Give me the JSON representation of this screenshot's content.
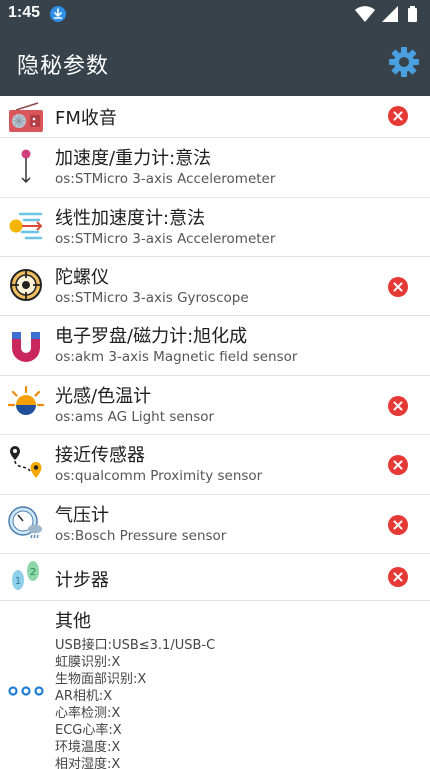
{
  "status": {
    "time": "1:45"
  },
  "app": {
    "title": "隐秘参数"
  },
  "sensors": [
    {
      "title": "FM收音",
      "sub": "",
      "icon": "radio-icon",
      "removable": true
    },
    {
      "title": "加速度/重力计:意法",
      "sub": "os:STMicro 3-axis Accelerometer",
      "icon": "accelerometer-icon",
      "removable": false
    },
    {
      "title": "线性加速度计:意法",
      "sub": "os:STMicro 3-axis Accelerometer",
      "icon": "linear-acceleration-icon",
      "removable": false
    },
    {
      "title": "陀螺仪",
      "sub": "os:STMicro 3-axis Gyroscope",
      "icon": "gyroscope-icon",
      "removable": true
    },
    {
      "title": "电子罗盘/磁力计:旭化成",
      "sub": "os:akm 3-axis Magnetic field sensor",
      "icon": "magnet-icon",
      "removable": false
    },
    {
      "title": "光感/色温计",
      "sub": "os:ams AG Light sensor",
      "icon": "light-sensor-icon",
      "removable": true
    },
    {
      "title": "接近传感器",
      "sub": "os:qualcomm Proximity sensor",
      "icon": "proximity-route-icon",
      "removable": true
    },
    {
      "title": "气压计",
      "sub": "os:Bosch Pressure sensor",
      "icon": "barometer-icon",
      "removable": true
    },
    {
      "title": "计步器",
      "sub": "",
      "icon": "footsteps-icon",
      "removable": true
    }
  ],
  "other": {
    "title": "其他",
    "icon": "more-dots-icon",
    "lines": [
      "USB接口:USB≤3.1/USB-C",
      "虹膜识别:X",
      "生物面部识别:X",
      "AR相机:X",
      "心率检测:X",
      "ECG心率:X",
      "环境温度:X",
      "相对湿度:X"
    ]
  },
  "colors": {
    "bar": "#37424a",
    "close": "#e53935",
    "settings": "#4a9fe0"
  }
}
